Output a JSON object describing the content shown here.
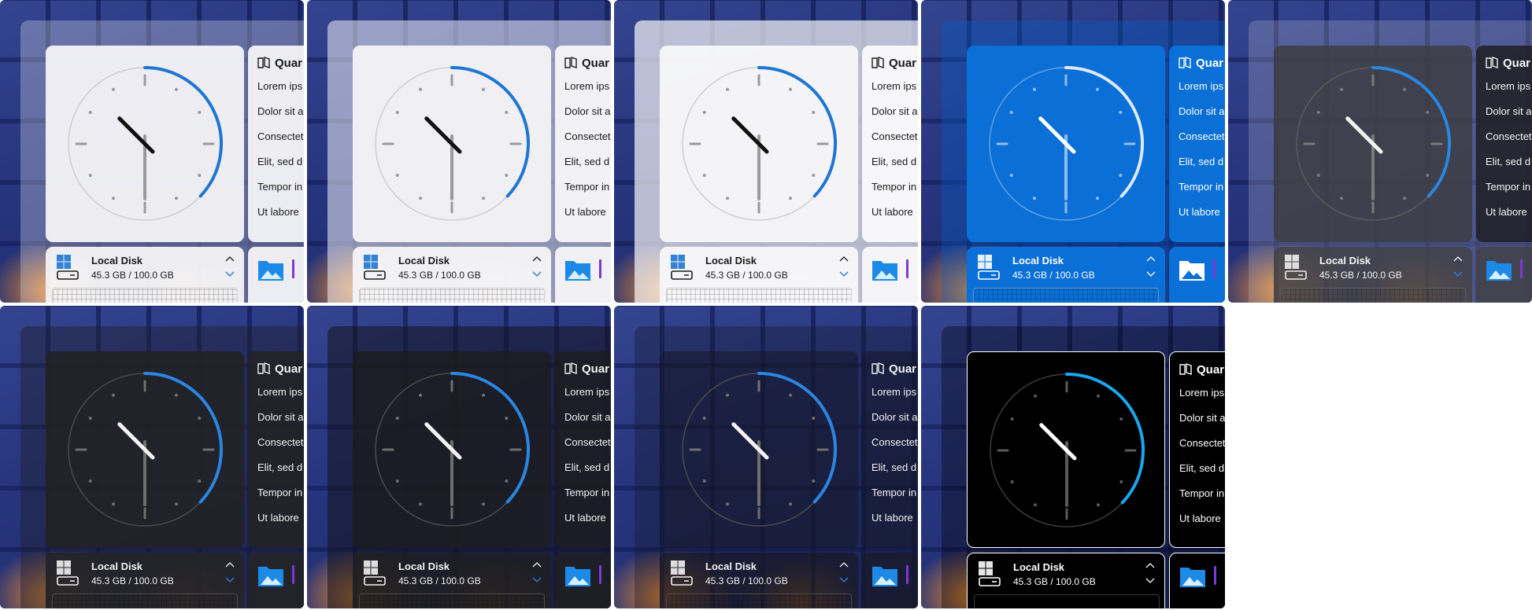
{
  "widget": {
    "list_title": "Quar",
    "list_items": [
      "Lorem ips",
      "Dolor sit a",
      "Consectet",
      "Elit, sed d",
      "Tempor in",
      "Ut labore"
    ],
    "disk_title": "Local Disk",
    "disk_size": "45.3 GB / 100.0 GB",
    "disk_usage_fraction": 0.453,
    "clock": {
      "hour": 10,
      "minute": 30,
      "progress_arc_fraction": 0.37
    }
  },
  "themes": [
    {
      "id": "light-mica",
      "panel": "rgba(235,235,242,0.30)",
      "card": "rgba(243,243,246,0.96)",
      "list": "rgba(245,245,248,0.94)",
      "text": "#1b1b1b",
      "hand": "#111111",
      "ticks": "#9a9a9a",
      "ring": "#cfcfcf",
      "accent": "#1f76d2",
      "disk": "rgba(244,244,247,0.95)",
      "icon": "#1b1b1b"
    },
    {
      "id": "light-acrylic",
      "panel": "rgba(240,240,248,0.55)",
      "card": "rgba(243,243,246,0.97)",
      "list": "rgba(246,246,248,0.96)",
      "text": "#1b1b1b",
      "hand": "#111111",
      "ticks": "#9a9a9a",
      "ring": "#cfcfcf",
      "accent": "#1f76d2",
      "disk": "rgba(245,245,247,0.96)",
      "icon": "#1b1b1b"
    },
    {
      "id": "light-solid",
      "panel": "rgba(248,248,250,0.70)",
      "card": "rgba(245,245,247,0.99)",
      "list": "rgba(248,248,250,0.98)",
      "text": "#1b1b1b",
      "hand": "#111111",
      "ticks": "#9a9a9a",
      "ring": "#cfcfcf",
      "accent": "#1f76d2",
      "disk": "rgba(246,246,248,0.98)",
      "icon": "#1b1b1b"
    },
    {
      "id": "accent-blue",
      "panel": "rgba(0,95,200,0.35)",
      "card": "#0a6fd6",
      "list": "#0a6fd6",
      "text": "#ffffff",
      "hand": "#ffffff",
      "ticks": "rgba(255,255,255,0.55)",
      "ring": "rgba(255,255,255,0.35)",
      "accent": "#dfe9f7",
      "disk": "#0a6fd6",
      "icon": "#ffffff"
    },
    {
      "id": "glass",
      "panel": "rgba(200,200,210,0.25)",
      "card": "rgba(60,60,64,0.82)",
      "list": "rgba(30,30,34,0.85)",
      "text": "#f4f4f4",
      "hand": "#f2f2f2",
      "ticks": "#7a7a7a",
      "ring": "#5b5b5b",
      "accent": "#2a86e0",
      "disk": "rgba(66,66,70,0.85)",
      "icon": "#eeeeee"
    },
    {
      "id": "dark-mica",
      "panel": "rgba(30,32,45,0.45)",
      "card": "rgba(34,34,38,0.92)",
      "list": "rgba(34,34,38,0.90)",
      "text": "#f2f2f2",
      "hand": "#f2f2f2",
      "ticks": "#6f6f6f",
      "ring": "#4a4a4a",
      "accent": "#2a86e0",
      "disk": "rgba(36,36,40,0.92)",
      "icon": "#f2f2f2"
    },
    {
      "id": "dark-acrylic",
      "panel": "rgba(20,20,28,0.55)",
      "card": "rgba(28,28,30,0.80)",
      "list": "rgba(28,28,30,0.78)",
      "text": "#f2f2f2",
      "hand": "#f2f2f2",
      "ticks": "#6f6f6f",
      "ring": "#4a4a4a",
      "accent": "#2a86e0",
      "disk": "rgba(30,30,34,0.85)",
      "icon": "#f2f2f2"
    },
    {
      "id": "dark-clear",
      "panel": "rgba(20,22,40,0.35)",
      "card": "rgba(22,24,40,0.55)",
      "list": "rgba(22,24,40,0.55)",
      "text": "#f2f2f2",
      "hand": "#f2f2f2",
      "ticks": "#6f6f6f",
      "ring": "#4a4a4a",
      "accent": "#2a86e0",
      "disk": "rgba(24,24,36,0.70)",
      "icon": "#f2f2f2"
    },
    {
      "id": "high-contrast",
      "panel": "rgba(0,0,0,0.35)",
      "card": "#000000",
      "list": "#000000",
      "text": "#ffffff",
      "hand": "#ffffff",
      "ticks": "#5a5a5a",
      "ring": "#3c3c3c",
      "accent": "#1aa6f0",
      "disk": "#000000",
      "icon": "#ffffff",
      "border": "#ffffff"
    }
  ]
}
